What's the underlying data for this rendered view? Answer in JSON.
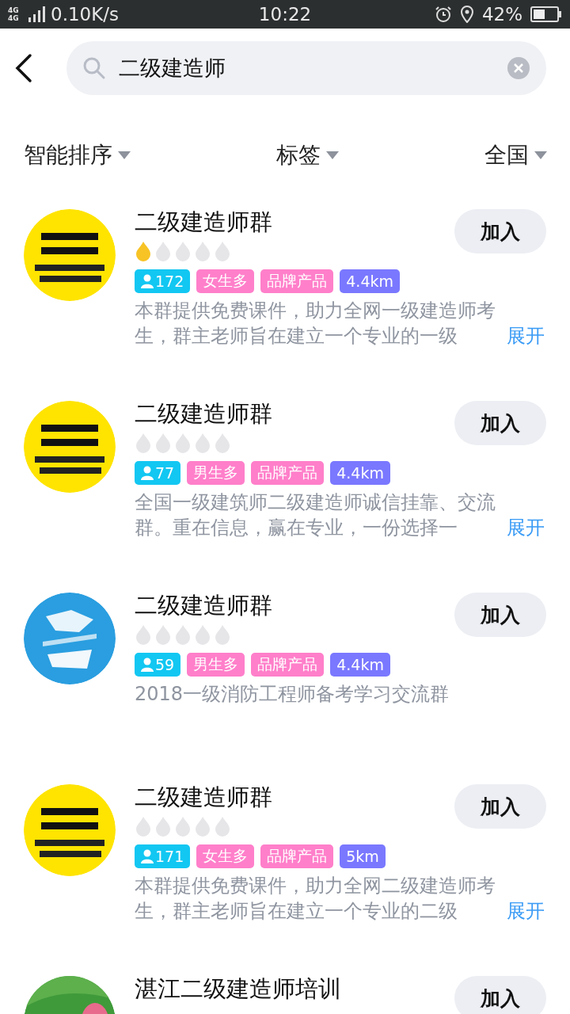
{
  "status_bar": {
    "network": "4G 4G",
    "speed": "0.10K/s",
    "time": "10:22",
    "battery": "42%"
  },
  "search": {
    "value": "二级建造师"
  },
  "filters": [
    {
      "label": "智能排序"
    },
    {
      "label": "标签"
    },
    {
      "label": "全国"
    }
  ],
  "groups": [
    {
      "avatar": {
        "kind": "picture",
        "color": "#ffe400"
      },
      "name": "二级建造师群",
      "stars": 1,
      "tags": [
        {
          "kind": "members",
          "text": "172"
        },
        {
          "kind": "gender",
          "text": "女生多"
        },
        {
          "kind": "brand",
          "text": "品牌产品"
        },
        {
          "kind": "distance",
          "text": "4.4km"
        }
      ],
      "description": "本群提供免费课件，助力全网一级建造师考生，群主老师旨在建立一个专业的一级",
      "expand": "展开",
      "button": "加入"
    },
    {
      "avatar": {
        "kind": "picture",
        "color": "#ffe400"
      },
      "name": "二级建造师群",
      "stars": 0,
      "tags": [
        {
          "kind": "members",
          "text": "77"
        },
        {
          "kind": "gender",
          "text": "男生多"
        },
        {
          "kind": "brand",
          "text": "品牌产品"
        },
        {
          "kind": "distance",
          "text": "4.4km"
        }
      ],
      "description": "全国一级建筑师二级建造师诚信挂靠、交流群。重在信息，赢在专业，一份选择一",
      "expand": "展开",
      "button": "加入"
    },
    {
      "avatar": {
        "kind": "picture",
        "color": "#2a9ee0"
      },
      "name": "二级建造师群",
      "stars": 0,
      "tags": [
        {
          "kind": "members",
          "text": "59"
        },
        {
          "kind": "gender",
          "text": "男生多"
        },
        {
          "kind": "brand",
          "text": "品牌产品"
        },
        {
          "kind": "distance",
          "text": "4.4km"
        }
      ],
      "description": "2018一级消防工程师备考学习交流群",
      "button": "加入"
    },
    {
      "avatar": {
        "kind": "picture",
        "color": "#ffe400"
      },
      "name": "二级建造师群",
      "stars": 0,
      "tags": [
        {
          "kind": "members",
          "text": "171"
        },
        {
          "kind": "gender",
          "text": "女生多"
        },
        {
          "kind": "brand",
          "text": "品牌产品"
        },
        {
          "kind": "distance",
          "text": "5km"
        }
      ],
      "description": "本群提供免费课件，助力全网二级建造师考生，群主老师旨在建立一个专业的二级",
      "expand": "展开",
      "button": "加入"
    },
    {
      "avatar": {
        "kind": "picture",
        "color": "#3f9a3a"
      },
      "name": "湛江二级建造师培训",
      "button": "加入"
    }
  ]
}
